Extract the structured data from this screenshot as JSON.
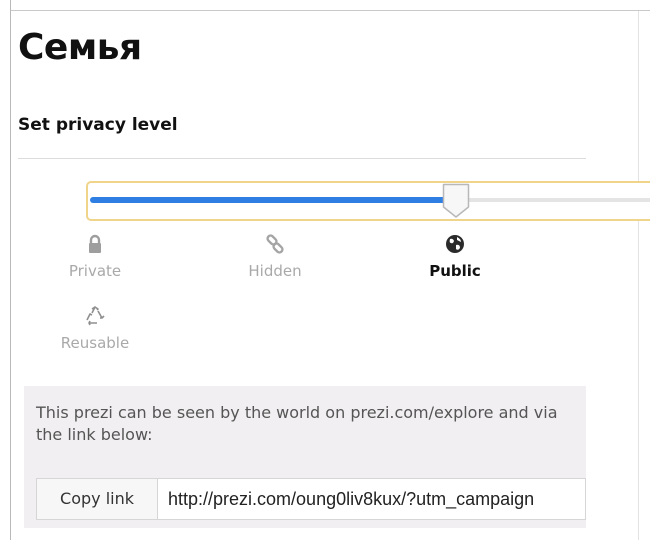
{
  "dialog": {
    "title": "Семья",
    "privacy_heading": "Set privacy level"
  },
  "privacy": {
    "selected": "Public",
    "slider_fraction": 0.65,
    "accent_color": "#2f7fe3",
    "highlight_color": "#f0d48a",
    "levels": [
      {
        "label": "Private",
        "icon": "lock-icon"
      },
      {
        "label": "Hidden",
        "icon": "link-icon"
      },
      {
        "label": "Public",
        "icon": "globe-icon"
      },
      {
        "label": "Reusable",
        "icon": "recycle-icon"
      }
    ]
  },
  "share": {
    "description": "This prezi can be seen by the world on prezi.com/explore and via the link below:",
    "copy_button_label": "Copy link",
    "link_value": "http://prezi.com/oung0liv8kux/?utm_campaign"
  }
}
